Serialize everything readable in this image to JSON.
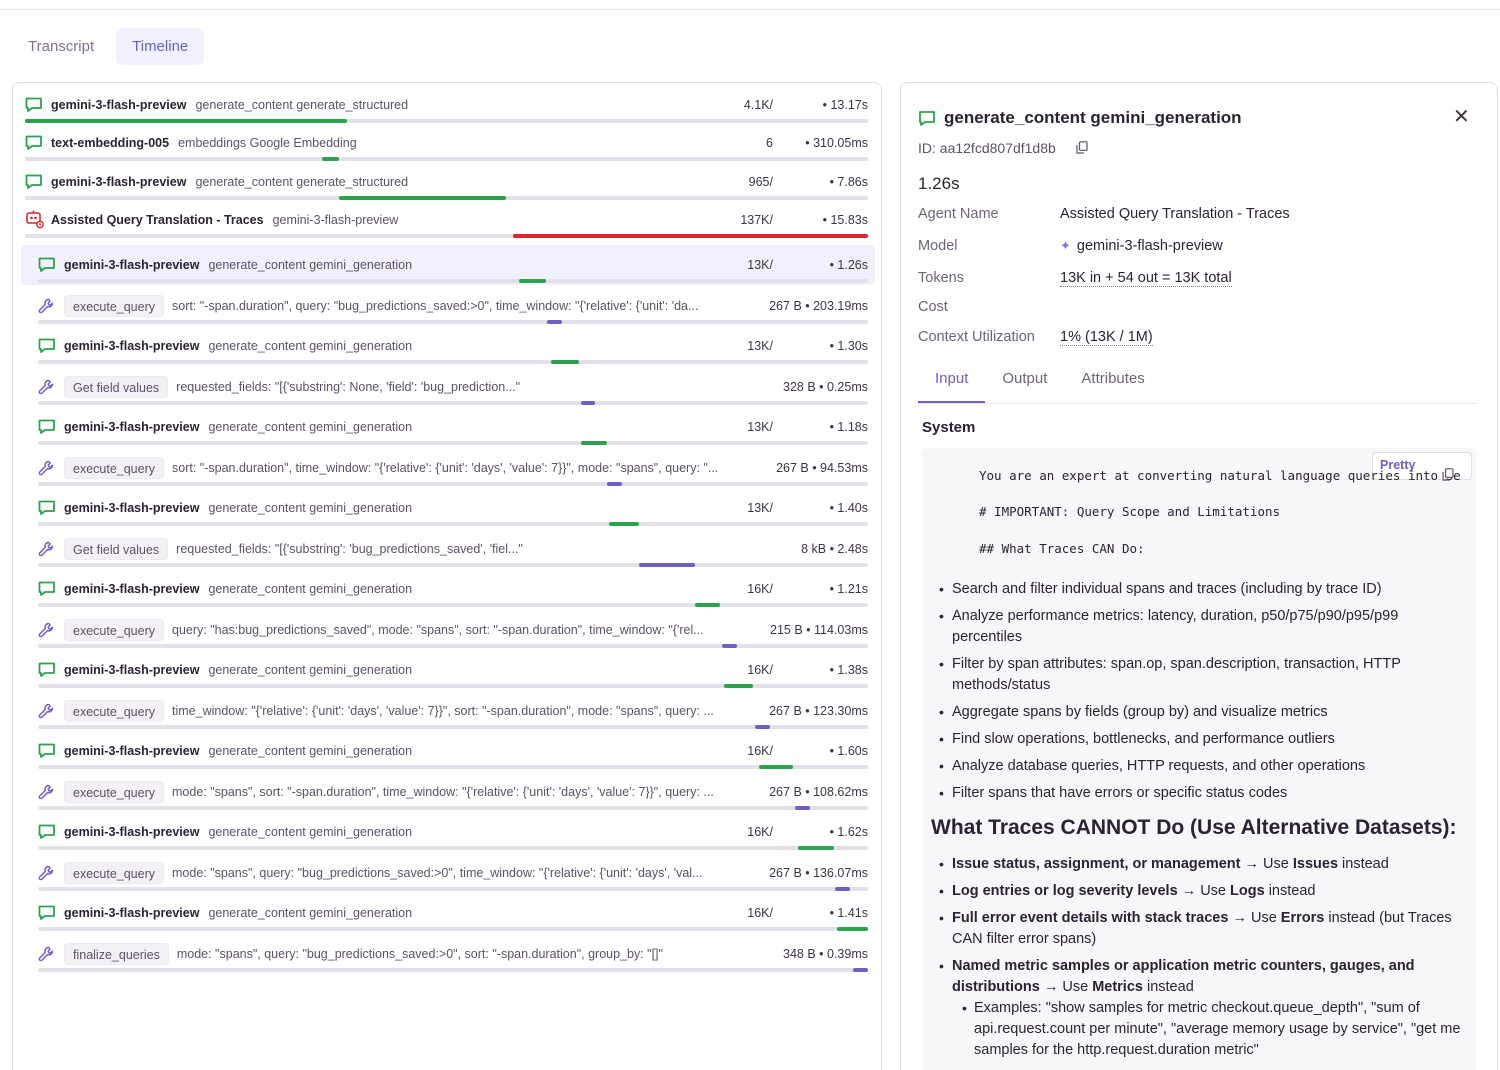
{
  "tabs": {
    "transcript": "Transcript",
    "timeline": "Timeline"
  },
  "colors": {
    "green": "#2ba24c",
    "purple": "#6c5fc7",
    "red": "#e0262d",
    "accent": "#6c5fc7"
  },
  "spans": [
    {
      "kind": "llm",
      "title": "gemini-3-flash-preview",
      "desc": "generate_content generate_structured",
      "tokens": "4.1K/",
      "dur": "• 13.17s",
      "bar_start": 0.0,
      "bar_end": 0.382,
      "color": "green"
    },
    {
      "kind": "llm",
      "title": "text-embedding-005",
      "desc": "embeddings Google Embedding",
      "tokens": "6",
      "dur": "• 310.05ms",
      "bar_start": 0.352,
      "bar_end": 0.372,
      "color": "green"
    },
    {
      "kind": "llm",
      "title": "gemini-3-flash-preview",
      "desc": "generate_content generate_structured",
      "tokens": "965/",
      "dur": "• 7.86s",
      "bar_start": 0.372,
      "bar_end": 0.571,
      "color": "green"
    },
    {
      "kind": "agent",
      "title": "Assisted Query Translation - Traces",
      "desc": "gemini-3-flash-preview",
      "tokens": "137K/",
      "dur": "• 15.83s",
      "bar_start": 0.579,
      "bar_end": 1.0,
      "color": "red"
    },
    {
      "kind": "llm",
      "title": "gemini-3-flash-preview",
      "desc": "generate_content gemini_generation",
      "tokens": "13K/",
      "dur": "• 1.26s",
      "bar_start": 0.579,
      "bar_end": 0.612,
      "color": "green",
      "selected": true
    },
    {
      "kind": "tool",
      "chip": "execute_query",
      "desc": "sort: \"-span.duration\", query: \"bug_predictions_saved:>0\", time_window: \"{'relative': {'unit': 'da...",
      "meta": "267 B • 203.19ms",
      "bar_start": 0.613,
      "bar_end": 0.631,
      "color": "purple"
    },
    {
      "kind": "llm",
      "title": "gemini-3-flash-preview",
      "desc": "generate_content gemini_generation",
      "tokens": "13K/",
      "dur": "• 1.30s",
      "bar_start": 0.618,
      "bar_end": 0.652,
      "color": "green"
    },
    {
      "kind": "tool",
      "chip": "Get field values",
      "desc": "requested_fields: \"[{'substring': None, 'field': 'bug_prediction...\"",
      "meta": "328 B • 0.25ms",
      "bar_start": 0.654,
      "bar_end": 0.671,
      "color": "purple"
    },
    {
      "kind": "llm",
      "title": "gemini-3-flash-preview",
      "desc": "generate_content gemini_generation",
      "tokens": "13K/",
      "dur": "• 1.18s",
      "bar_start": 0.654,
      "bar_end": 0.686,
      "color": "green"
    },
    {
      "kind": "tool",
      "chip": "execute_query",
      "desc": "sort: \"-span.duration\", time_window: \"{'relative': {'unit': 'days', 'value': 7}}\", mode: \"spans\", query: \"...",
      "meta": "267 B • 94.53ms",
      "bar_start": 0.686,
      "bar_end": 0.704,
      "color": "purple"
    },
    {
      "kind": "llm",
      "title": "gemini-3-flash-preview",
      "desc": "generate_content gemini_generation",
      "tokens": "13K/",
      "dur": "• 1.40s",
      "bar_start": 0.688,
      "bar_end": 0.724,
      "color": "green"
    },
    {
      "kind": "tool",
      "chip": "Get field values",
      "desc": "requested_fields: \"[{'substring': 'bug_predictions_saved', 'fiel...\"",
      "meta": "8 kB • 2.48s",
      "bar_start": 0.724,
      "bar_end": 0.791,
      "color": "purple"
    },
    {
      "kind": "llm",
      "title": "gemini-3-flash-preview",
      "desc": "generate_content gemini_generation",
      "tokens": "16K/",
      "dur": "• 1.21s",
      "bar_start": 0.791,
      "bar_end": 0.822,
      "color": "green"
    },
    {
      "kind": "tool",
      "chip": "execute_query",
      "desc": "query: \"has:bug_predictions_saved\", mode: \"spans\", sort: \"-span.duration\", time_window: \"{'rel...",
      "meta": "215 B • 114.03ms",
      "bar_start": 0.824,
      "bar_end": 0.842,
      "color": "purple"
    },
    {
      "kind": "llm",
      "title": "gemini-3-flash-preview",
      "desc": "generate_content gemini_generation",
      "tokens": "16K/",
      "dur": "• 1.38s",
      "bar_start": 0.826,
      "bar_end": 0.862,
      "color": "green"
    },
    {
      "kind": "tool",
      "chip": "execute_query",
      "desc": "time_window: \"{'relative': {'unit': 'days', 'value': 7}}\", sort: \"-span.duration\", mode: \"spans\", query: ...",
      "meta": "267 B • 123.30ms",
      "bar_start": 0.864,
      "bar_end": 0.882,
      "color": "purple"
    },
    {
      "kind": "llm",
      "title": "gemini-3-flash-preview",
      "desc": "generate_content gemini_generation",
      "tokens": "16K/",
      "dur": "• 1.60s",
      "bar_start": 0.869,
      "bar_end": 0.91,
      "color": "green"
    },
    {
      "kind": "tool",
      "chip": "execute_query",
      "desc": "mode: \"spans\", sort: \"-span.duration\", time_window: \"{'relative': {'unit': 'days', 'value': 7}}\", query: ...",
      "meta": "267 B • 108.62ms",
      "bar_start": 0.912,
      "bar_end": 0.93,
      "color": "purple"
    },
    {
      "kind": "llm",
      "title": "gemini-3-flash-preview",
      "desc": "generate_content gemini_generation",
      "tokens": "16K/",
      "dur": "• 1.62s",
      "bar_start": 0.916,
      "bar_end": 0.959,
      "color": "green"
    },
    {
      "kind": "tool",
      "chip": "execute_query",
      "desc": "mode: \"spans\", query: \"bug_predictions_saved:>0\", time_window: \"{'relative': {'unit': 'days', 'val...",
      "meta": "267 B • 136.07ms",
      "bar_start": 0.96,
      "bar_end": 0.978,
      "color": "purple"
    },
    {
      "kind": "llm",
      "title": "gemini-3-flash-preview",
      "desc": "generate_content gemini_generation",
      "tokens": "16K/",
      "dur": "• 1.41s",
      "bar_start": 0.963,
      "bar_end": 1.0,
      "color": "green"
    },
    {
      "kind": "tool",
      "chip": "finalize_queries",
      "desc": "mode: \"spans\", query: \"bug_predictions_saved:>0\", sort: \"-span.duration\", group_by: \"[]\"",
      "meta": "348 B • 0.39ms",
      "bar_start": 0.982,
      "bar_end": 1.0,
      "color": "purple"
    }
  ],
  "detail": {
    "title": "generate_content gemini_generation",
    "id": "ID: aa12fcd807df1d8b",
    "duration": "1.26s",
    "fields": [
      {
        "label": "Agent Name",
        "value": "Assisted Query Translation - Traces"
      },
      {
        "label": "Model",
        "value": "gemini-3-flash-preview"
      },
      {
        "label": "Tokens",
        "value": "13K in + 54 out = 13K total"
      },
      {
        "label": "Cost",
        "value": ""
      },
      {
        "label": "Context Utilization",
        "value": "1% (13K / 1M)"
      }
    ],
    "tabs": [
      "Input",
      "Output",
      "Attributes"
    ],
    "system_label": "System",
    "pretty_label": "Pretty",
    "code_lines": [
      "You are an expert at converting natural language queries into Se",
      "# IMPORTANT: Query Scope and Limitations",
      "## What Traces CAN Do:"
    ],
    "can_do": [
      "Search and filter individual spans and traces (including by trace ID)",
      "Analyze performance metrics: latency, duration, p50/p75/p90/p95/p99 percentiles",
      "Filter by span attributes: span.op, span.description, transaction, HTTP methods/status",
      "Aggregate spans by fields (group by) and visualize metrics",
      "Find slow operations, bottlenecks, and performance outliers",
      "Analyze database queries, HTTP requests, and other operations",
      "Filter spans that have errors or specific status codes"
    ],
    "cannot_heading": "What Traces CANNOT Do (Use Alternative Datasets):",
    "cannot_do": [
      {
        "bold": "Issue status, assignment, or management",
        "arrow": " → Use ",
        "bold2": "Issues",
        "rest": " instead"
      },
      {
        "bold": "Log entries or log severity levels",
        "arrow": " → Use ",
        "bold2": "Logs",
        "rest": " instead"
      },
      {
        "bold": "Full error event details with stack traces",
        "arrow": " → Use ",
        "bold2": "Errors",
        "rest": " instead (but Traces CAN filter error spans)"
      },
      {
        "bold": "Named metric samples or application metric counters, gauges, and distributions",
        "arrow": " → Use ",
        "bold2": "Metrics",
        "rest": " instead"
      }
    ],
    "example": "Examples: \"show samples for metric checkout.queue_depth\", \"sum of api.request.count per minute\", \"average memory usage by service\", \"get me samples for the http.request.duration metric\""
  }
}
